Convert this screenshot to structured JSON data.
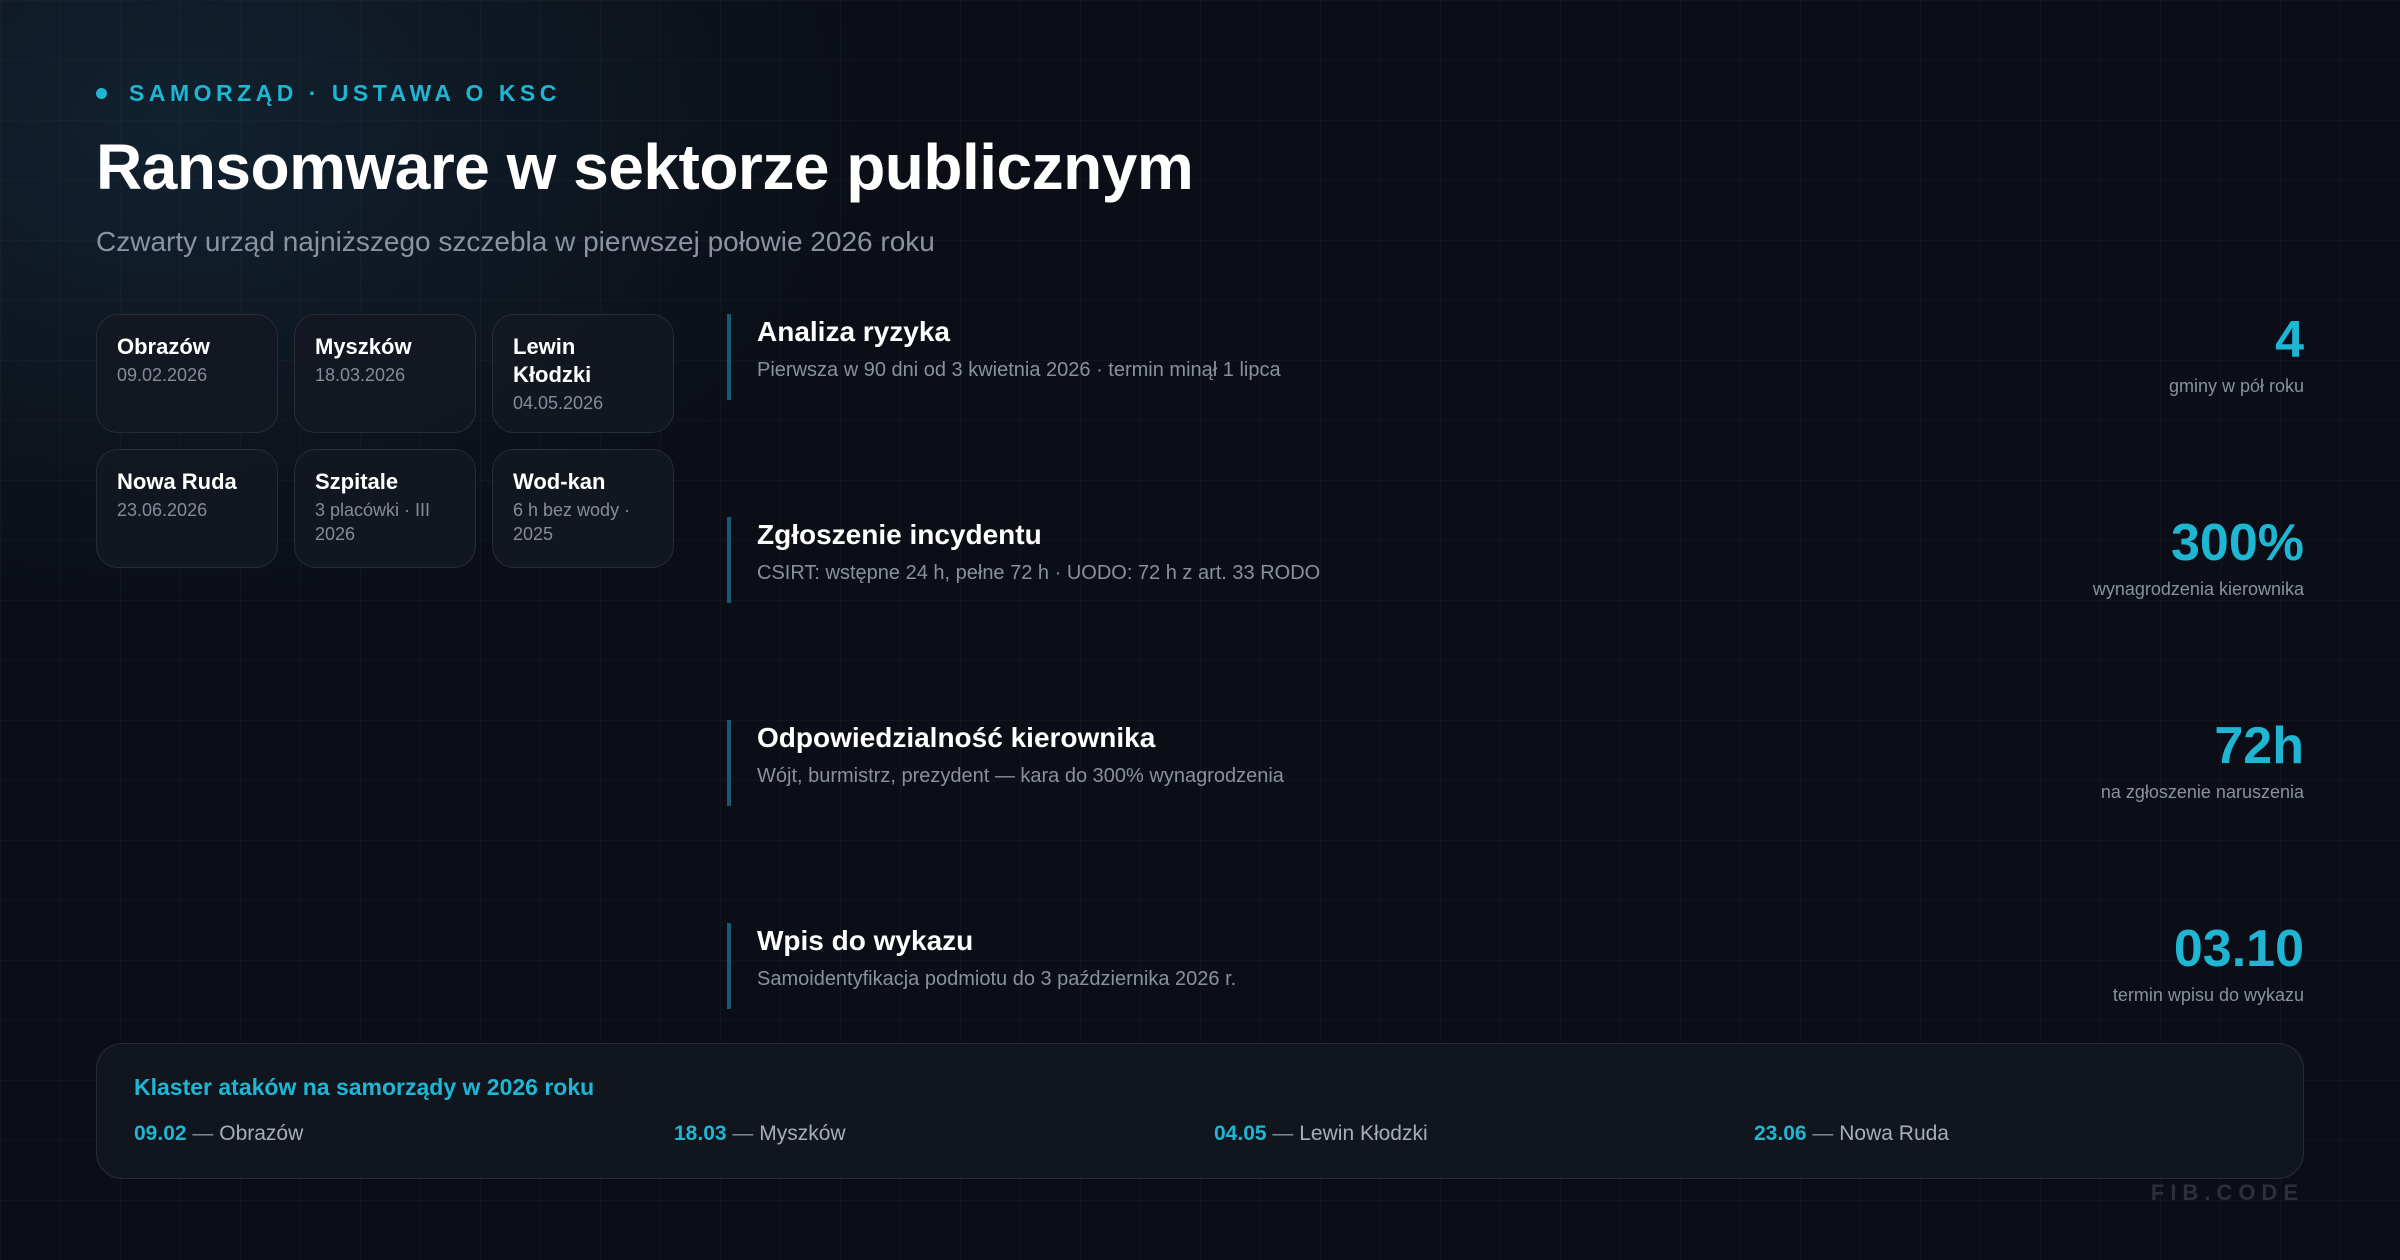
{
  "kicker": "SAMORZĄD · USTAWA O KSC",
  "title": "Ransomware w sektorze publicznym",
  "subtitle": "Czwarty urząd najniższego szczebla w pierwszej połowie 2026 roku",
  "cards": [
    {
      "name": "Obrazów",
      "detail": "09.02.2026"
    },
    {
      "name": "Myszków",
      "detail": "18.03.2026"
    },
    {
      "name": "Lewin Kłodzki",
      "detail": "04.05.2026"
    },
    {
      "name": "Nowa Ruda",
      "detail": "23.06.2026"
    },
    {
      "name": "Szpitale",
      "detail": "3 placówki · III 2026"
    },
    {
      "name": "Wod-kan",
      "detail": "6 h bez wody · 2025"
    }
  ],
  "items": [
    {
      "title": "Analiza ryzyka",
      "desc": "Pierwsza w 90 dni od 3 kwietnia 2026 · termin minął 1 lipca",
      "value": "4",
      "caption": "gminy w pół roku"
    },
    {
      "title": "Zgłoszenie incydentu",
      "desc": "CSIRT: wstępne 24 h, pełne 72 h · UODO: 72 h z art. 33 RODO",
      "value": "300%",
      "caption": "wynagrodzenia kierownika"
    },
    {
      "title": "Odpowiedzialność kierownika",
      "desc": "Wójt, burmistrz, prezydent — kara do 300% wynagrodzenia",
      "value": "72h",
      "caption": "na zgłoszenie naruszenia"
    },
    {
      "title": "Wpis do wykazu",
      "desc": "Samoidentyfikacja podmiotu do 3 października 2026 r.",
      "value": "03.10",
      "caption": "termin wpisu do wykazu"
    }
  ],
  "cluster": {
    "title": "Klaster ataków na samorządy w 2026 roku",
    "separator": "—",
    "events": [
      {
        "date": "09.02",
        "place": "Obrazów"
      },
      {
        "date": "18.03",
        "place": "Myszków"
      },
      {
        "date": "04.05",
        "place": "Lewin Kłodzki"
      },
      {
        "date": "23.06",
        "place": "Nowa Ruda"
      }
    ]
  },
  "brand": "FIB.CODE",
  "colors": {
    "accent": "#1fb6d3",
    "background": "#0b0e16",
    "muted": "#8a919e"
  }
}
